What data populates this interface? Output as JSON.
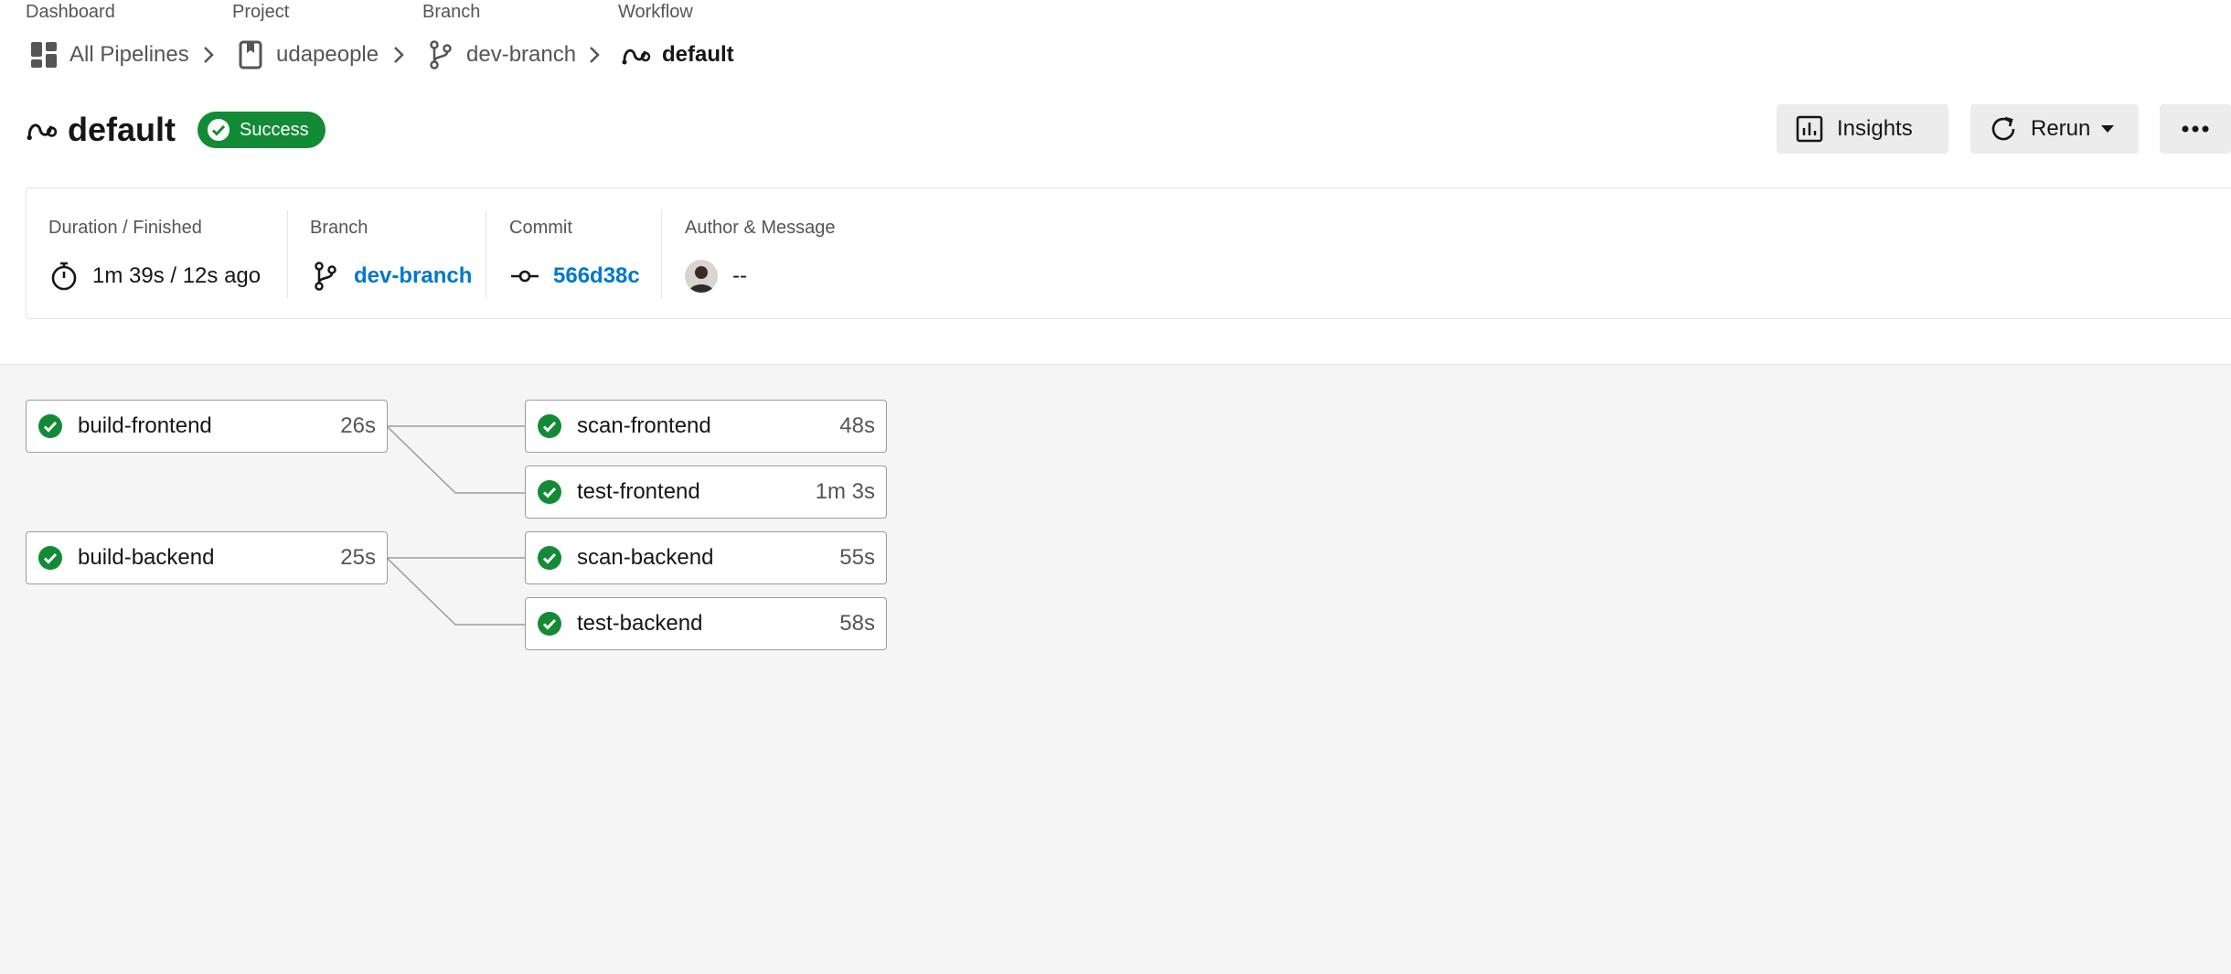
{
  "breadcrumb": {
    "dashboard": {
      "caption": "Dashboard",
      "label": "All Pipelines"
    },
    "project": {
      "caption": "Project",
      "label": "udapeople"
    },
    "branch": {
      "caption": "Branch",
      "label": "dev-branch"
    },
    "workflow": {
      "caption": "Workflow",
      "label": "default"
    }
  },
  "header": {
    "title": "default",
    "status": "Success",
    "insights_label": "Insights",
    "rerun_label": "Rerun"
  },
  "summary": {
    "duration_label": "Duration / Finished",
    "duration_value": "1m 39s / 12s ago",
    "branch_label": "Branch",
    "branch_value": "dev-branch",
    "commit_label": "Commit",
    "commit_value": "566d38c",
    "author_label": "Author & Message",
    "author_message": "--"
  },
  "jobs": [
    {
      "name": "build-frontend",
      "duration": "26s",
      "status": "success"
    },
    {
      "name": "scan-frontend",
      "duration": "48s",
      "status": "success"
    },
    {
      "name": "test-frontend",
      "duration": "1m 3s",
      "status": "success"
    },
    {
      "name": "build-backend",
      "duration": "25s",
      "status": "success"
    },
    {
      "name": "scan-backend",
      "duration": "55s",
      "status": "success"
    },
    {
      "name": "test-backend",
      "duration": "58s",
      "status": "success"
    }
  ],
  "colors": {
    "success": "#138a36",
    "link": "#0078ca",
    "graph_bg": "#f5f5f5"
  },
  "icons": {
    "dashboard": "dashboard-grid-icon",
    "project": "bookmark-icon",
    "branch": "git-branch-icon",
    "workflow": "workflow-icon",
    "status": "check-circle-icon",
    "insights": "bar-chart-icon",
    "rerun": "refresh-icon",
    "more": "more-horizontal-icon",
    "duration": "stopwatch-icon",
    "commit": "git-commit-icon"
  }
}
